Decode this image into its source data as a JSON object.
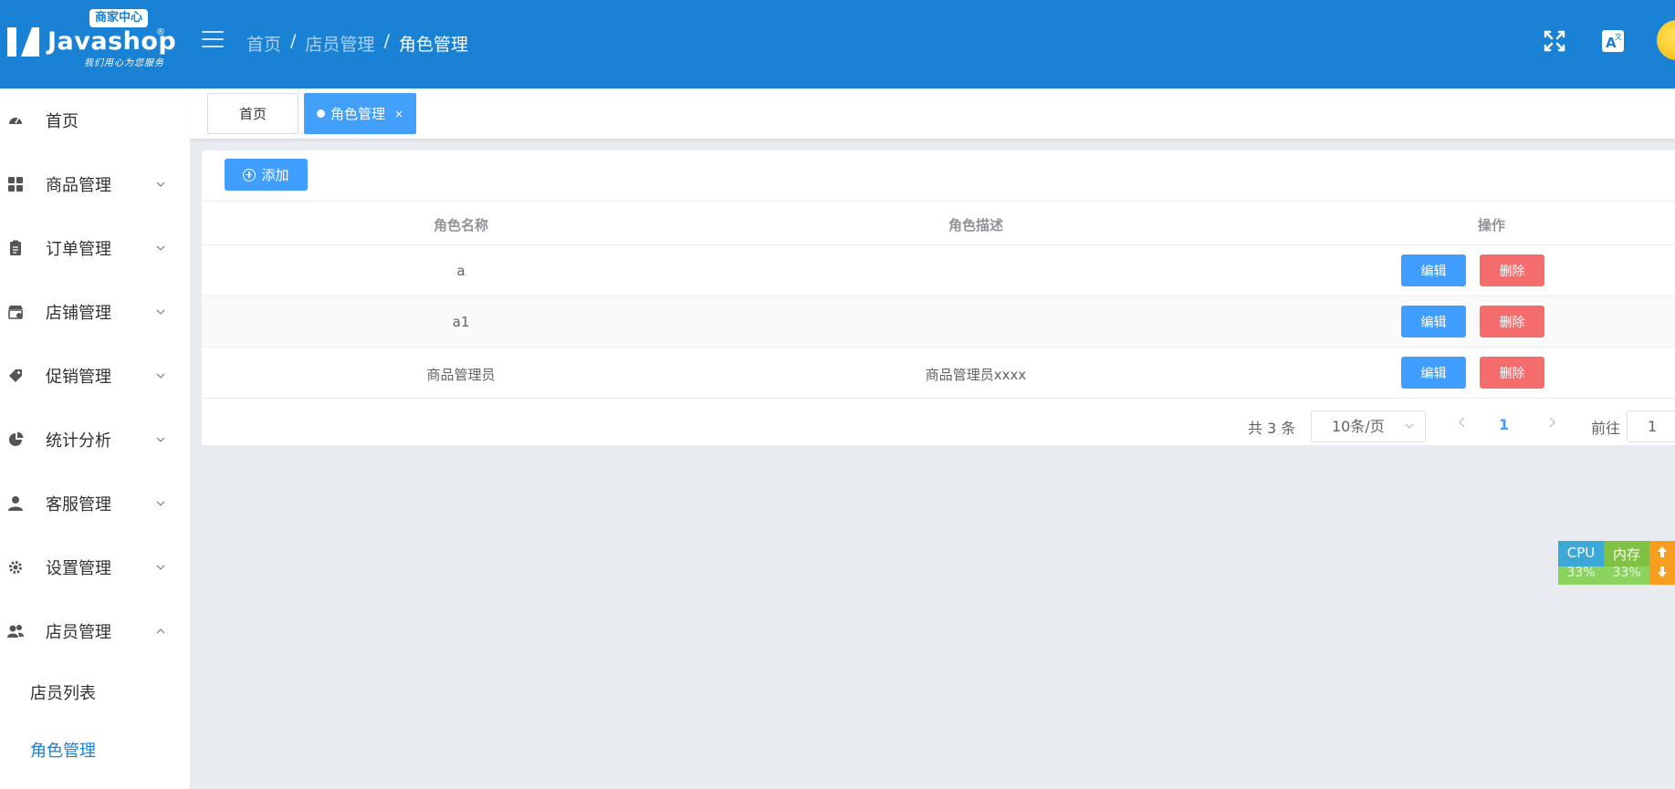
{
  "logo": {
    "badge": "商家中心",
    "name": "Javashop",
    "registered": "®",
    "slogan": "我们用心为您服务"
  },
  "breadcrumb": [
    "首页",
    "店员管理",
    "角色管理"
  ],
  "breadcrumb_separator": "/",
  "header_icons": [
    "fullscreen-icon",
    "translate-icon"
  ],
  "sidebar": {
    "items": [
      {
        "label": "首页",
        "icon": "dashboard-icon",
        "expandable": false
      },
      {
        "label": "商品管理",
        "icon": "grid-icon",
        "expandable": true
      },
      {
        "label": "订单管理",
        "icon": "clipboard-icon",
        "expandable": true
      },
      {
        "label": "店铺管理",
        "icon": "store-icon",
        "expandable": true
      },
      {
        "label": "促销管理",
        "icon": "tag-icon",
        "expandable": true
      },
      {
        "label": "统计分析",
        "icon": "pie-chart-icon",
        "expandable": true
      },
      {
        "label": "客服管理",
        "icon": "user-icon",
        "expandable": true
      },
      {
        "label": "设置管理",
        "icon": "gear-icon",
        "expandable": true
      },
      {
        "label": "店员管理",
        "icon": "users-icon",
        "expandable": true,
        "expanded": true
      }
    ],
    "sub_items": [
      {
        "label": "店员列表",
        "active": false
      },
      {
        "label": "角色管理",
        "active": true
      }
    ]
  },
  "tabs": [
    {
      "label": "首页",
      "active": false
    },
    {
      "label": "角色管理",
      "active": true,
      "close": "×"
    }
  ],
  "toolbar": {
    "add_label": "添加"
  },
  "table": {
    "headers": [
      "角色名称",
      "角色描述",
      "操作"
    ],
    "rows": [
      {
        "name": "a",
        "description": "",
        "edit": "编辑",
        "delete": "删除"
      },
      {
        "name": "a1",
        "description": "",
        "edit": "编辑",
        "delete": "删除"
      },
      {
        "name": "商品管理员",
        "description": "商品管理员xxxx",
        "edit": "编辑",
        "delete": "删除"
      }
    ]
  },
  "pagination": {
    "total": "共 3 条",
    "page_size": "10条/页",
    "current_page": "1",
    "goto_label": "前往",
    "goto_value": "1"
  },
  "perf_widget": {
    "cpu_label": "CPU",
    "cpu_value": "33%",
    "mem_label": "内存",
    "mem_value": "33%"
  },
  "colors": {
    "header": "#1a82d4",
    "primary": "#409eff",
    "danger": "#f56c6c",
    "active_tab": "#42a0fb"
  }
}
